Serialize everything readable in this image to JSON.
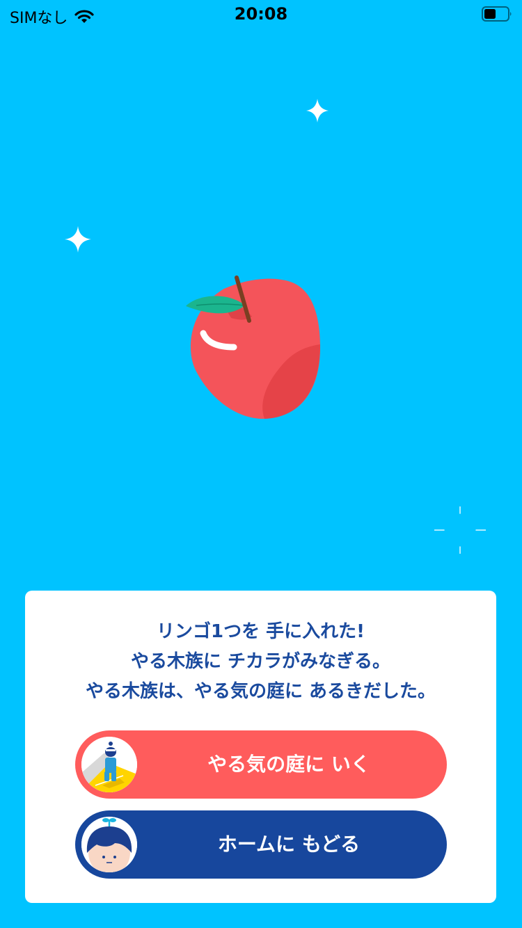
{
  "status_bar": {
    "carrier": "SIMなし",
    "time": "20:08",
    "icons": [
      "wifi-icon",
      "battery-icon"
    ]
  },
  "reward": {
    "item_icon": "apple-icon",
    "message_lines": [
      "リンゴ1つを 手に入れた!",
      "やる木族に チカラがみなぎる。",
      "やる木族は、やる気の庭に あるきだした。"
    ]
  },
  "buttons": {
    "garden": {
      "label": "やる気の庭に いく",
      "icon": "garden-character-avatar",
      "color": "#FF5C5C"
    },
    "home": {
      "label": "ホームに もどる",
      "icon": "home-character-avatar",
      "color": "#17479D"
    }
  },
  "colors": {
    "background": "#00C3FF",
    "dialog": "#FFFFFF",
    "message_text": "#1A4A9E"
  }
}
